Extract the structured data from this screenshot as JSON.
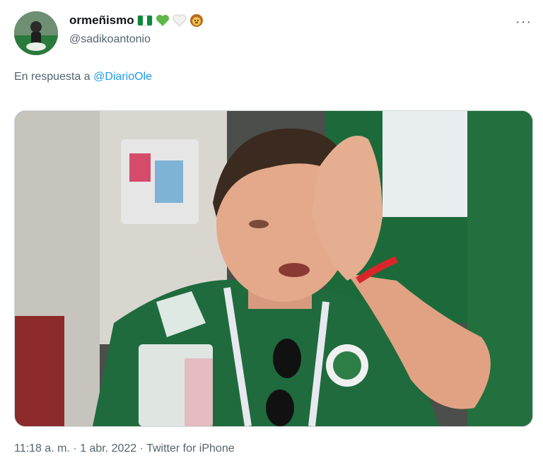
{
  "tweet": {
    "display_name": "ormeñismo",
    "name_emojis": [
      "nigeria-flag-icon",
      "green-heart-icon",
      "white-heart-icon",
      "lion-face-icon"
    ],
    "handle": "@sadikoantonio",
    "reply_prefix": "En respuesta a",
    "reply_to": "@DiarioOle",
    "more_label": "···",
    "time": "11:18 a. m.",
    "date": "1 abr. 2022",
    "source": "Twitter for iPhone",
    "separator": "·"
  },
  "colors": {
    "link": "#1d9bf0",
    "secondary_text": "#536471",
    "jersey_green": "#1f6b3d"
  }
}
